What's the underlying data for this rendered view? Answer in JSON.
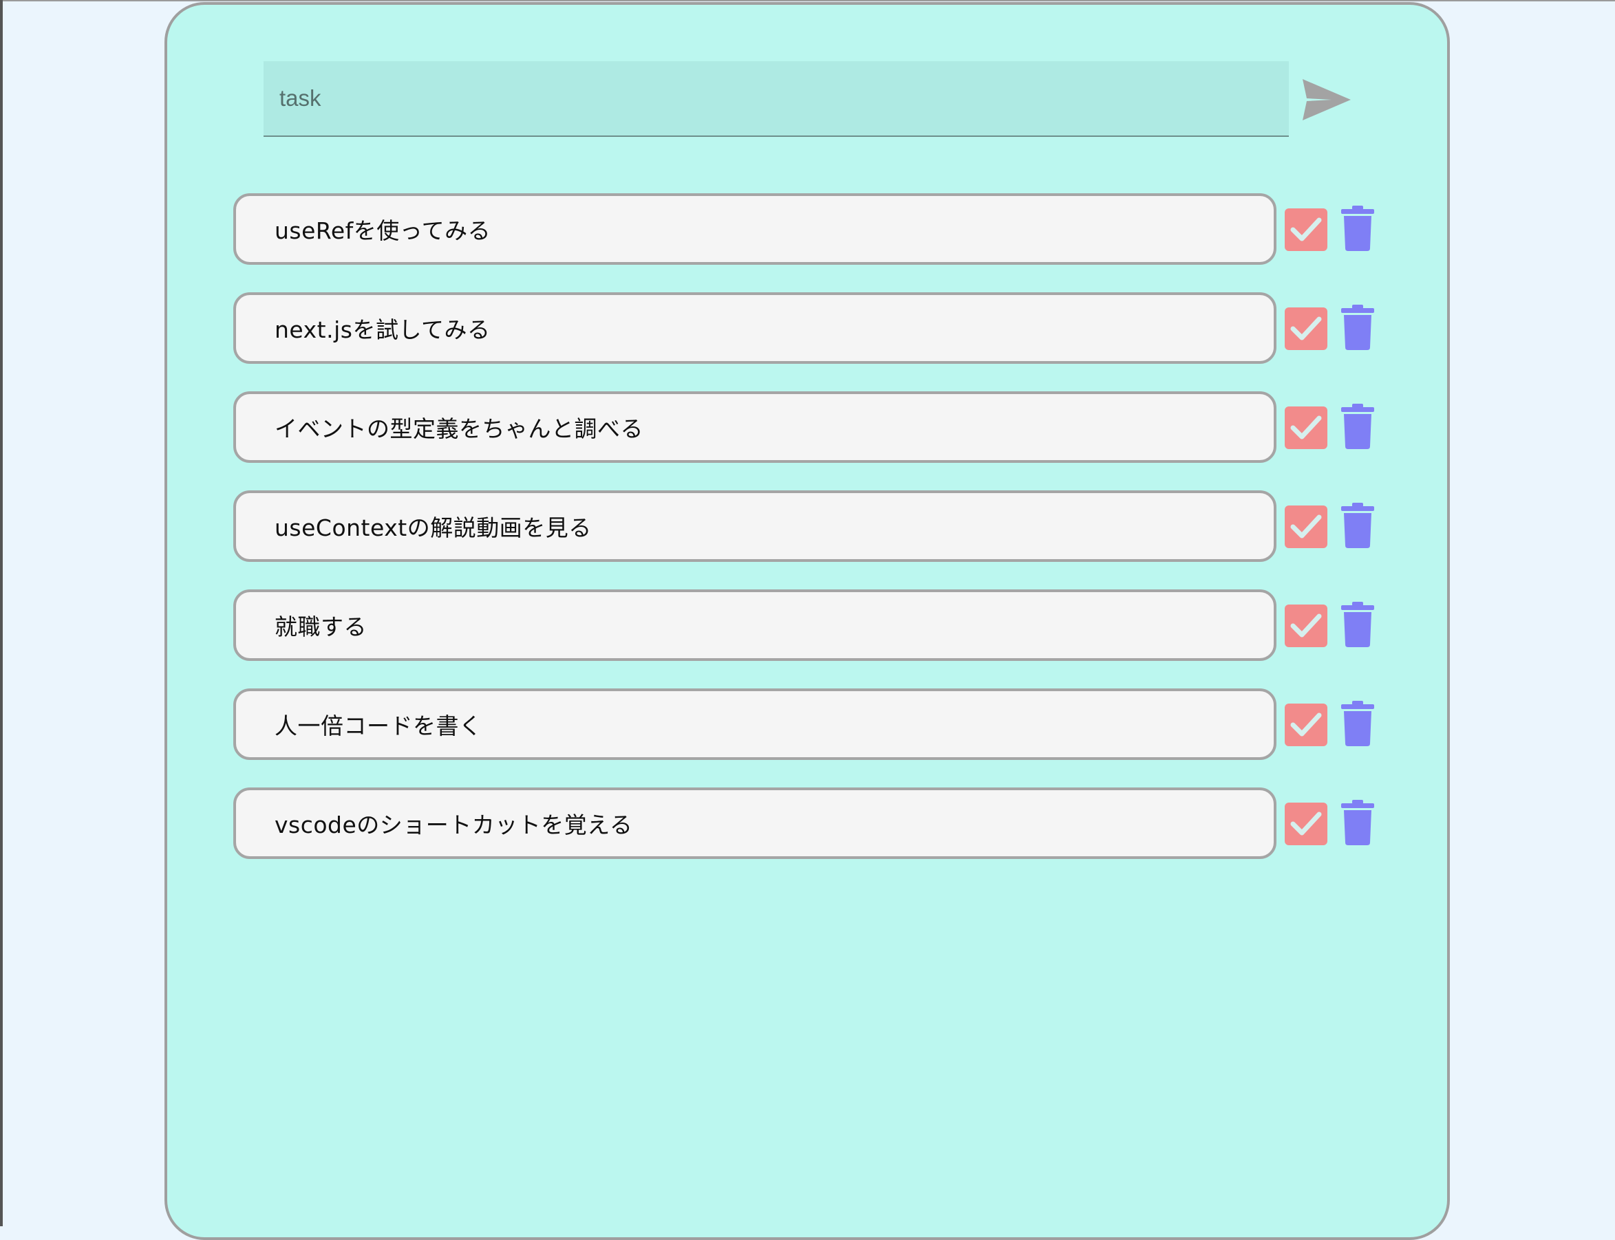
{
  "input": {
    "placeholder": "task",
    "value": ""
  },
  "icons": {
    "send": "send-icon",
    "check": "check-icon",
    "delete": "trash-icon"
  },
  "colors": {
    "background": "#ebf5fd",
    "panel": "#bbf7ef",
    "input": "#aeeae3",
    "card": "#f5f5f5",
    "check": "#f28b8b",
    "trash": "#7f7ff5",
    "send": "#a3a3a3"
  },
  "todos": [
    {
      "text": "useRefを使ってみる"
    },
    {
      "text": "next.jsを試してみる"
    },
    {
      "text": "イベントの型定義をちゃんと調べる"
    },
    {
      "text": "useContextの解説動画を見る"
    },
    {
      "text": "就職する"
    },
    {
      "text": "人一倍コードを書く"
    },
    {
      "text": "vscodeのショートカットを覚える"
    }
  ]
}
